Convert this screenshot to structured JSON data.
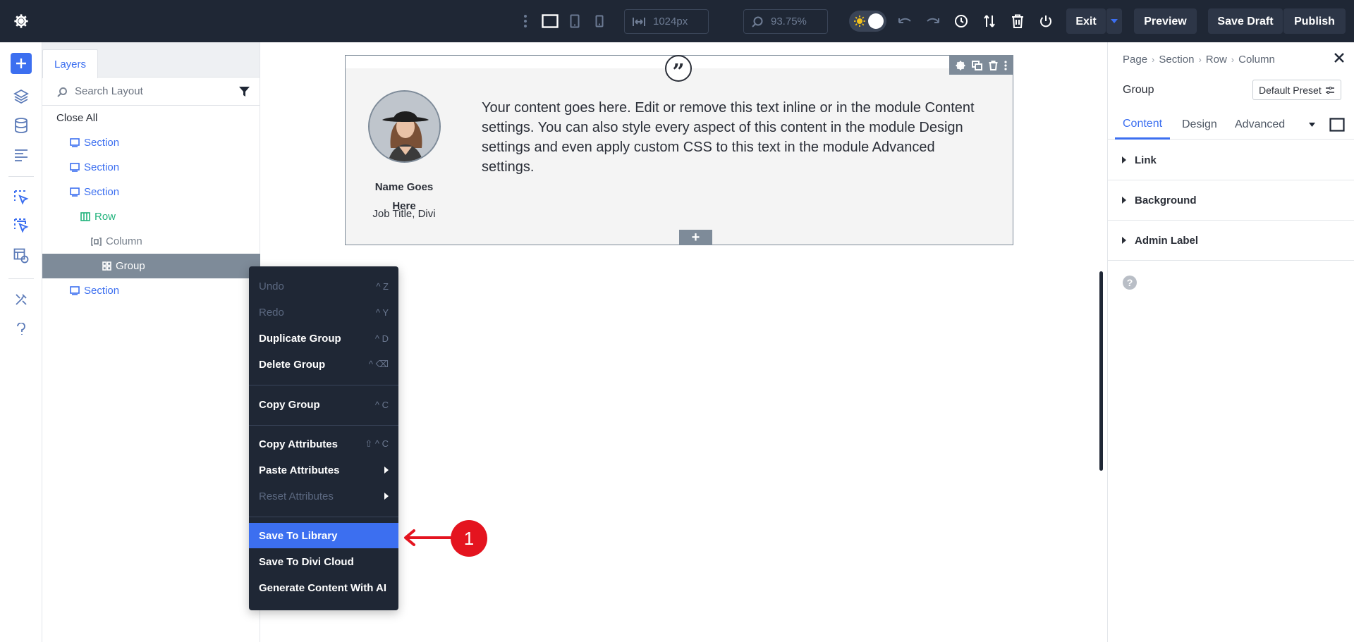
{
  "topbar": {
    "width_label": "1024px",
    "zoom_label": "93.75%",
    "exit_label": "Exit",
    "preview_label": "Preview",
    "save_draft_label": "Save Draft",
    "publish_label": "Publish"
  },
  "layers": {
    "tab_label": "Layers",
    "search_placeholder": "Search Layout",
    "close_all": "Close All",
    "tree": [
      {
        "label": "Section",
        "type": "section"
      },
      {
        "label": "Section",
        "type": "section"
      },
      {
        "label": "Section",
        "type": "section"
      },
      {
        "label": "Row",
        "type": "row"
      },
      {
        "label": "Column",
        "type": "column"
      },
      {
        "label": "Group",
        "type": "group",
        "selected": true
      },
      {
        "label": "Section",
        "type": "section"
      }
    ]
  },
  "module": {
    "quote_glyph": "”",
    "name": "Name Goes Here",
    "job": "Job Title, Divi",
    "body": "Your content goes here. Edit or remove this text inline or in the module Content settings. You can also style every aspect of this content in the module Design settings and even apply custom CSS to this text in the module Advanced settings.",
    "add_glyph": "+"
  },
  "context_menu": {
    "items": [
      {
        "label": "Undo",
        "shortcut": "^ Z",
        "disabled": true
      },
      {
        "label": "Redo",
        "shortcut": "^ Y",
        "disabled": true
      },
      {
        "label": "Duplicate Group",
        "shortcut": "^ D"
      },
      {
        "label": "Delete Group",
        "shortcut": "^ ⌫"
      },
      {
        "label": "Copy Group",
        "shortcut": "^ C"
      },
      {
        "label": "Copy Attributes",
        "shortcut": "⇧ ^ C"
      },
      {
        "label": "Paste Attributes",
        "submenu": true
      },
      {
        "label": "Reset Attributes",
        "submenu": true,
        "disabled": true
      },
      {
        "label": "Save To Library",
        "active": true
      },
      {
        "label": "Save To Divi Cloud"
      },
      {
        "label": "Generate Content With AI"
      }
    ]
  },
  "annotation": {
    "badge": "1",
    "color": "#e4141f"
  },
  "settings": {
    "breadcrumb": [
      "Page",
      "Section",
      "Row",
      "Column"
    ],
    "title": "Group",
    "preset_label": "Default Preset",
    "tabs": [
      "Content",
      "Design",
      "Advanced"
    ],
    "active_tab": "Content",
    "accordions": [
      "Link",
      "Background",
      "Admin Label"
    ],
    "help_glyph": "?"
  },
  "colors": {
    "topbar_bg": "#1f2735",
    "accent": "#3c6ff0",
    "row_green": "#21b37c",
    "selected_gray": "#7e8b99"
  }
}
